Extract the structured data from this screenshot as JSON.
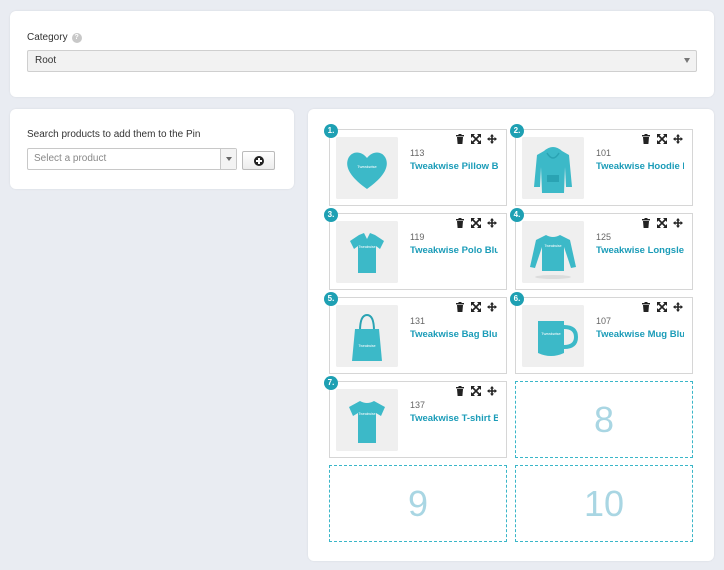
{
  "category": {
    "label": "Category",
    "help_icon": "question-circle-icon",
    "selected": "Root"
  },
  "search": {
    "label": "Search products to add them to the Pin",
    "placeholder": "Select a product",
    "add_icon": "plus-circle-icon"
  },
  "colors": {
    "accent": "#1ea0b3",
    "product_teal": "#3cb9c8",
    "link": "#1b9cb8",
    "empty_number": "#a9d6e3"
  },
  "pins": [
    {
      "position": "1.",
      "id": "113",
      "name": "Tweakwise Pillow Blue",
      "image": "heart-pillow"
    },
    {
      "position": "2.",
      "id": "101",
      "name": "Tweakwise Hoodie Blue",
      "image": "hoodie"
    },
    {
      "position": "3.",
      "id": "119",
      "name": "Tweakwise Polo Blue",
      "image": "polo"
    },
    {
      "position": "4.",
      "id": "125",
      "name": "Tweakwise Longsleeve Blue",
      "image": "longsleeve"
    },
    {
      "position": "5.",
      "id": "131",
      "name": "Tweakwise Bag Blue",
      "image": "tote-bag"
    },
    {
      "position": "6.",
      "id": "107",
      "name": "Tweakwise Mug Blue",
      "image": "mug"
    },
    {
      "position": "7.",
      "id": "137",
      "name": "Tweakwise T-shirt Blue",
      "image": "tshirt"
    }
  ],
  "empty_slots": [
    "8",
    "9",
    "10"
  ],
  "tool_icons": [
    "trash-icon",
    "expand-icon",
    "move-icon"
  ]
}
